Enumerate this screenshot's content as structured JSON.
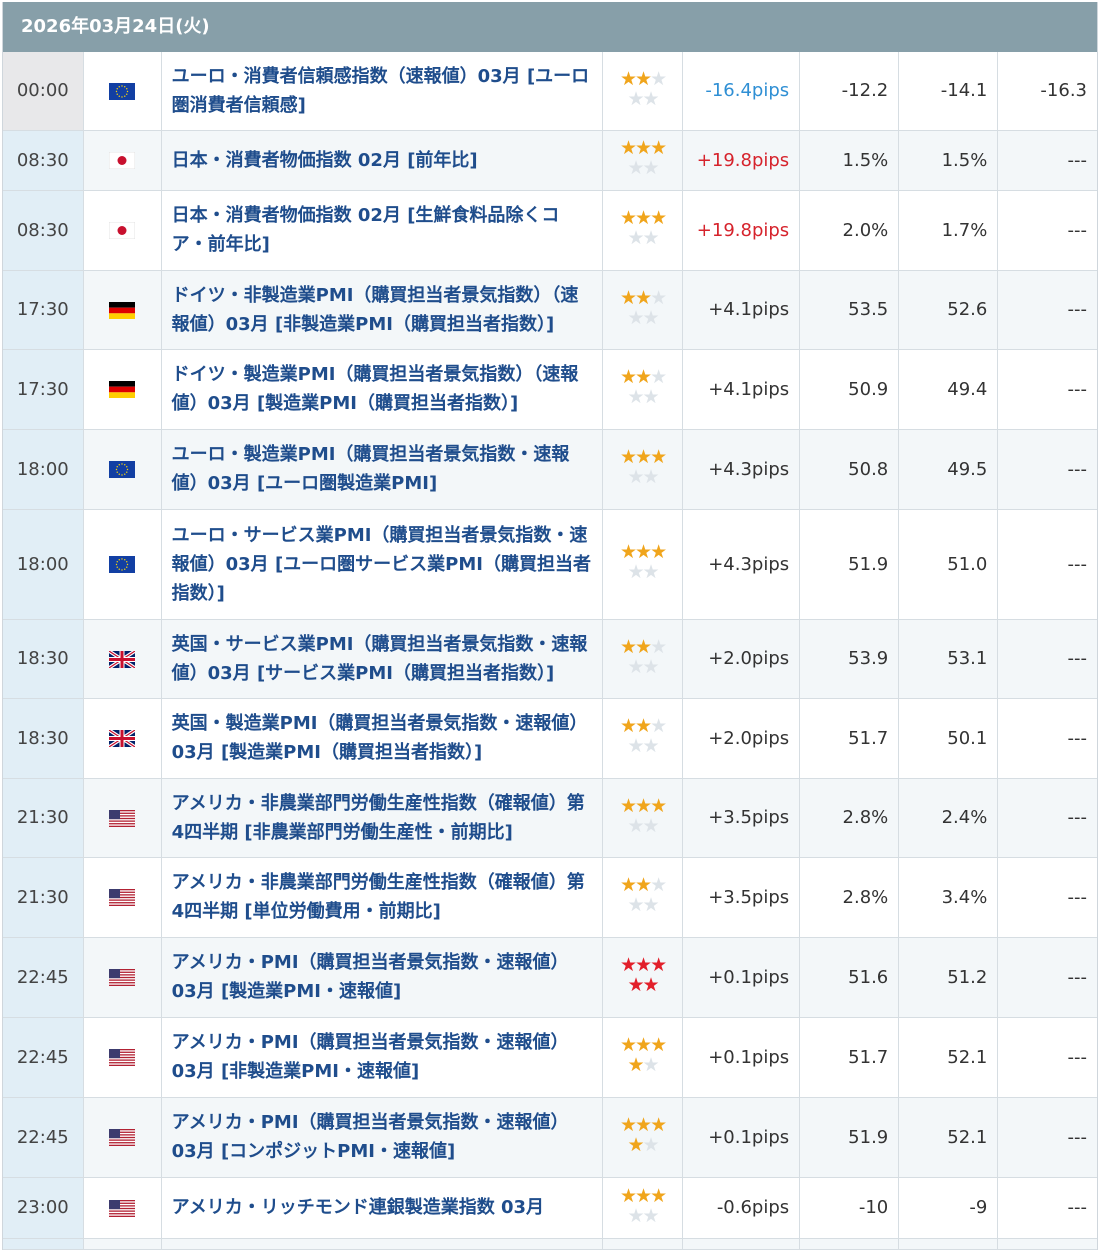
{
  "date": "2026年03月24日(火)",
  "rows": [
    {
      "time": "00:00",
      "country": "eu",
      "name": "ユーロ・消費者信頼感指数（速報値）03月 [ユーロ圏消費者信頼感]",
      "stars": 2,
      "color": "orange",
      "pips": "-16.4pips",
      "pips_sign": "neg",
      "result": "-12.2",
      "forecast": "-14.1",
      "previous": "-16.3",
      "active": true
    },
    {
      "time": "08:30",
      "country": "jp",
      "name": "日本・消費者物価指数 02月 [前年比]",
      "stars": 3,
      "color": "orange",
      "pips": "+19.8pips",
      "pips_sign": "pos",
      "result": "1.5%",
      "forecast": "1.5%",
      "previous": "---"
    },
    {
      "time": "08:30",
      "country": "jp",
      "name": "日本・消費者物価指数 02月 [生鮮食料品除くコア・前年比]",
      "stars": 3,
      "color": "orange",
      "pips": "+19.8pips",
      "pips_sign": "pos",
      "result": "2.0%",
      "forecast": "1.7%",
      "previous": "---"
    },
    {
      "time": "17:30",
      "country": "de",
      "name": "ドイツ・非製造業PMI（購買担当者景気指数）（速報値）03月 [非製造業PMI（購買担当者指数）]",
      "stars": 2,
      "color": "orange",
      "pips": "+4.1pips",
      "pips_sign": "none",
      "result": "53.5",
      "forecast": "52.6",
      "previous": "---"
    },
    {
      "time": "17:30",
      "country": "de",
      "name": "ドイツ・製造業PMI（購買担当者景気指数）（速報値）03月 [製造業PMI（購買担当者指数）]",
      "stars": 2,
      "color": "orange",
      "pips": "+4.1pips",
      "pips_sign": "none",
      "result": "50.9",
      "forecast": "49.4",
      "previous": "---"
    },
    {
      "time": "18:00",
      "country": "eu",
      "name": "ユーロ・製造業PMI（購買担当者景気指数・速報値）03月 [ユーロ圏製造業PMI]",
      "stars": 3,
      "color": "orange",
      "pips": "+4.3pips",
      "pips_sign": "none",
      "result": "50.8",
      "forecast": "49.5",
      "previous": "---"
    },
    {
      "time": "18:00",
      "country": "eu",
      "name": "ユーロ・サービス業PMI（購買担当者景気指数・速報値）03月 [ユーロ圏サービス業PMI（購買担当者指数）]",
      "stars": 3,
      "color": "orange",
      "pips": "+4.3pips",
      "pips_sign": "none",
      "result": "51.9",
      "forecast": "51.0",
      "previous": "---"
    },
    {
      "time": "18:30",
      "country": "uk",
      "name": "英国・サービス業PMI（購買担当者景気指数・速報値）03月 [サービス業PMI（購買担当者指数）]",
      "stars": 2,
      "color": "orange",
      "pips": "+2.0pips",
      "pips_sign": "none",
      "result": "53.9",
      "forecast": "53.1",
      "previous": "---"
    },
    {
      "time": "18:30",
      "country": "uk",
      "name": "英国・製造業PMI（購買担当者景気指数・速報値）03月 [製造業PMI（購買担当者指数）]",
      "stars": 2,
      "color": "orange",
      "pips": "+2.0pips",
      "pips_sign": "none",
      "result": "51.7",
      "forecast": "50.1",
      "previous": "---"
    },
    {
      "time": "21:30",
      "country": "us",
      "name": "アメリカ・非農業部門労働生産性指数（確報値）第4四半期 [非農業部門労働生産性・前期比]",
      "stars": 3,
      "color": "orange",
      "pips": "+3.5pips",
      "pips_sign": "none",
      "result": "2.8%",
      "forecast": "2.4%",
      "previous": "---"
    },
    {
      "time": "21:30",
      "country": "us",
      "name": "アメリカ・非農業部門労働生産性指数（確報値）第4四半期 [単位労働費用・前期比]",
      "stars": 2,
      "color": "orange",
      "pips": "+3.5pips",
      "pips_sign": "none",
      "result": "2.8%",
      "forecast": "3.4%",
      "previous": "---"
    },
    {
      "time": "22:45",
      "country": "us",
      "name": "アメリカ・PMI（購買担当者景気指数・速報値）03月 [製造業PMI・速報値]",
      "stars": 5,
      "color": "red",
      "pips": "+0.1pips",
      "pips_sign": "none",
      "result": "51.6",
      "forecast": "51.2",
      "previous": "---"
    },
    {
      "time": "22:45",
      "country": "us",
      "name": "アメリカ・PMI（購買担当者景気指数・速報値）03月 [非製造業PMI・速報値]",
      "stars": 4,
      "color": "orange",
      "pips": "+0.1pips",
      "pips_sign": "none",
      "result": "51.7",
      "forecast": "52.1",
      "previous": "---"
    },
    {
      "time": "22:45",
      "country": "us",
      "name": "アメリカ・PMI（購買担当者景気指数・速報値）03月 [コンポジットPMI・速報値]",
      "stars": 4,
      "color": "orange",
      "pips": "+0.1pips",
      "pips_sign": "none",
      "result": "51.9",
      "forecast": "52.1",
      "previous": "---"
    },
    {
      "time": "23:00",
      "country": "us",
      "name": "アメリカ・リッチモンド連銀製造業指数 03月",
      "stars": 3,
      "color": "orange",
      "pips": "-0.6pips",
      "pips_sign": "none",
      "result": "-10",
      "forecast": "-9",
      "previous": "---"
    }
  ]
}
